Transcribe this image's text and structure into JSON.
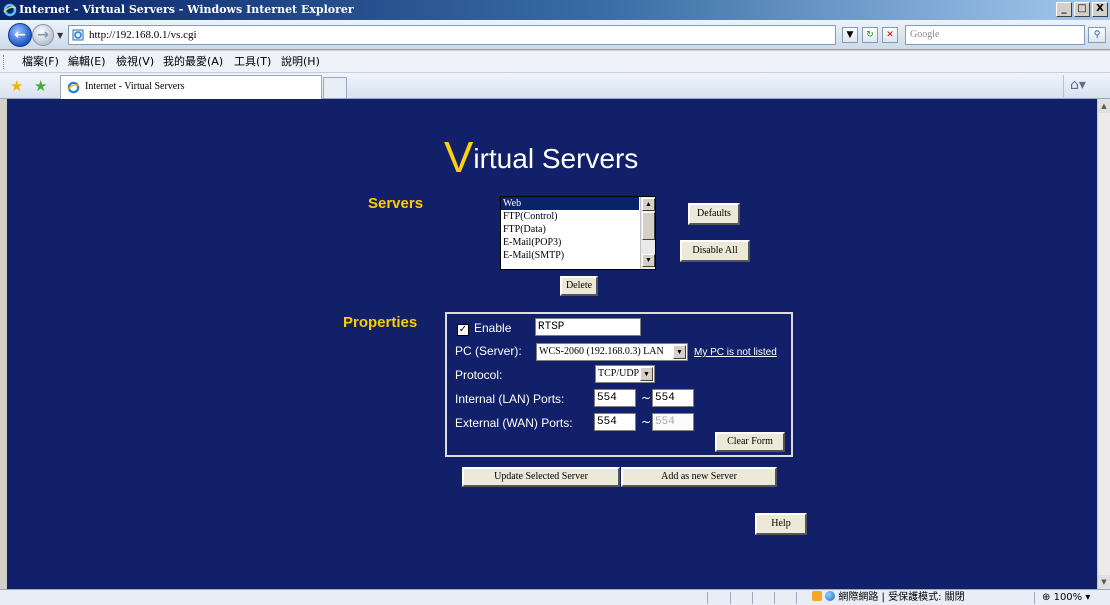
{
  "window": {
    "title": "Internet - Virtual Servers - Windows Internet Explorer",
    "controls": [
      "_",
      "□",
      "X"
    ]
  },
  "address_bar": {
    "url": "http://192.168.0.1/vs.cgi",
    "search_placeholder": "Google"
  },
  "menu": {
    "items": [
      "檔案(F)",
      "編輯(E)",
      "檢視(V)",
      "我的最愛(A)",
      "工具(T)",
      "說明(H)"
    ]
  },
  "tab": {
    "label": "Internet - Virtual Servers"
  },
  "page": {
    "title_first_letter": "V",
    "title_rest": "irtual Servers",
    "servers_label": "Servers",
    "properties_label": "Properties",
    "servers_list": [
      "Web",
      "FTP(Control)",
      "FTP(Data)",
      "E-Mail(POP3)",
      "E-Mail(SMTP)"
    ],
    "selected_server": "Web",
    "buttons": {
      "defaults": "Defaults",
      "disable_all": "Disable All",
      "delete": "Delete",
      "clear_form": "Clear Form",
      "update": "Update Selected Server",
      "add_new": "Add as new Server",
      "help": "Help"
    },
    "properties": {
      "enable_label": "Enable",
      "enable_checked": true,
      "name_value": "RTSP",
      "pc_label": "PC (Server):",
      "pc_value": "WCS-2060 (192.168.0.3) LAN",
      "pc_link": "My PC is not listed",
      "protocol_label": "Protocol:",
      "protocol_value": "TCP/UDP",
      "internal_label": "Internal (LAN) Ports:",
      "internal_from": "554",
      "internal_to": "554",
      "external_label": "External (WAN) Ports:",
      "external_from": "554",
      "external_to": "554",
      "range_sep": "~"
    }
  },
  "status": {
    "zone": "網際網路 | 受保護模式: 關閉",
    "zoom": "100%"
  },
  "colors": {
    "page_bg": "#122069",
    "heading_accent": "#ffcc00",
    "title_v": "#ffd10a"
  }
}
